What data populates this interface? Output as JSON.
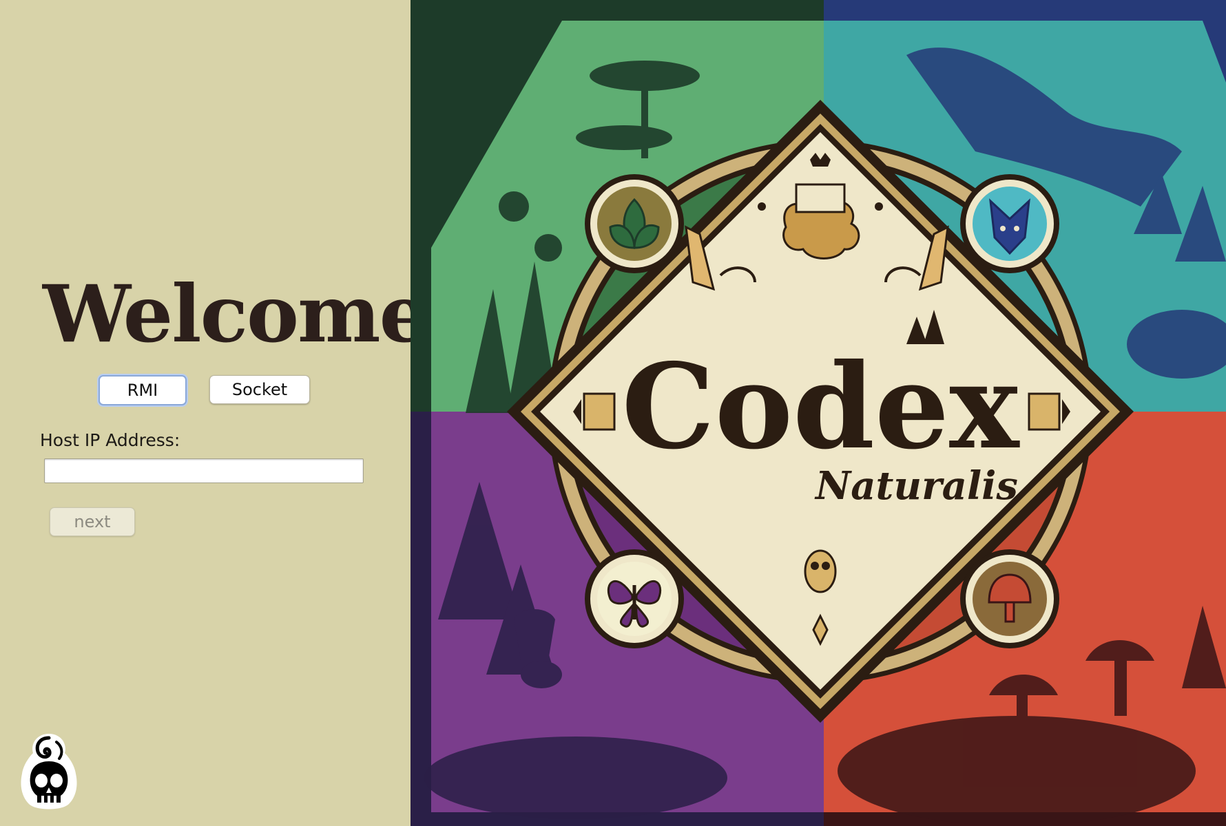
{
  "welcome": {
    "title": "Welcome",
    "connection_buttons": [
      {
        "label": "RMI",
        "selected": true
      },
      {
        "label": "Socket",
        "selected": false
      }
    ],
    "host_ip_label": "Host IP Address:",
    "host_ip_value": "",
    "host_ip_placeholder": "",
    "next_label": "next",
    "next_enabled": false
  },
  "cover_art": {
    "title": "Codex",
    "subtitle": "Naturalis",
    "quadrant_colors": {
      "top_left": "#5fae73",
      "top_right": "#3fa7a4",
      "bottom_left": "#7a3d8c",
      "bottom_right": "#d5503a"
    },
    "emblems": [
      "leaf-icon",
      "fox-icon",
      "butterfly-icon",
      "mushroom-icon"
    ]
  },
  "colors": {
    "panel_background": "#d8d3a9",
    "title_color": "#2c1f1b",
    "selected_outline": "#8aa8d8"
  }
}
